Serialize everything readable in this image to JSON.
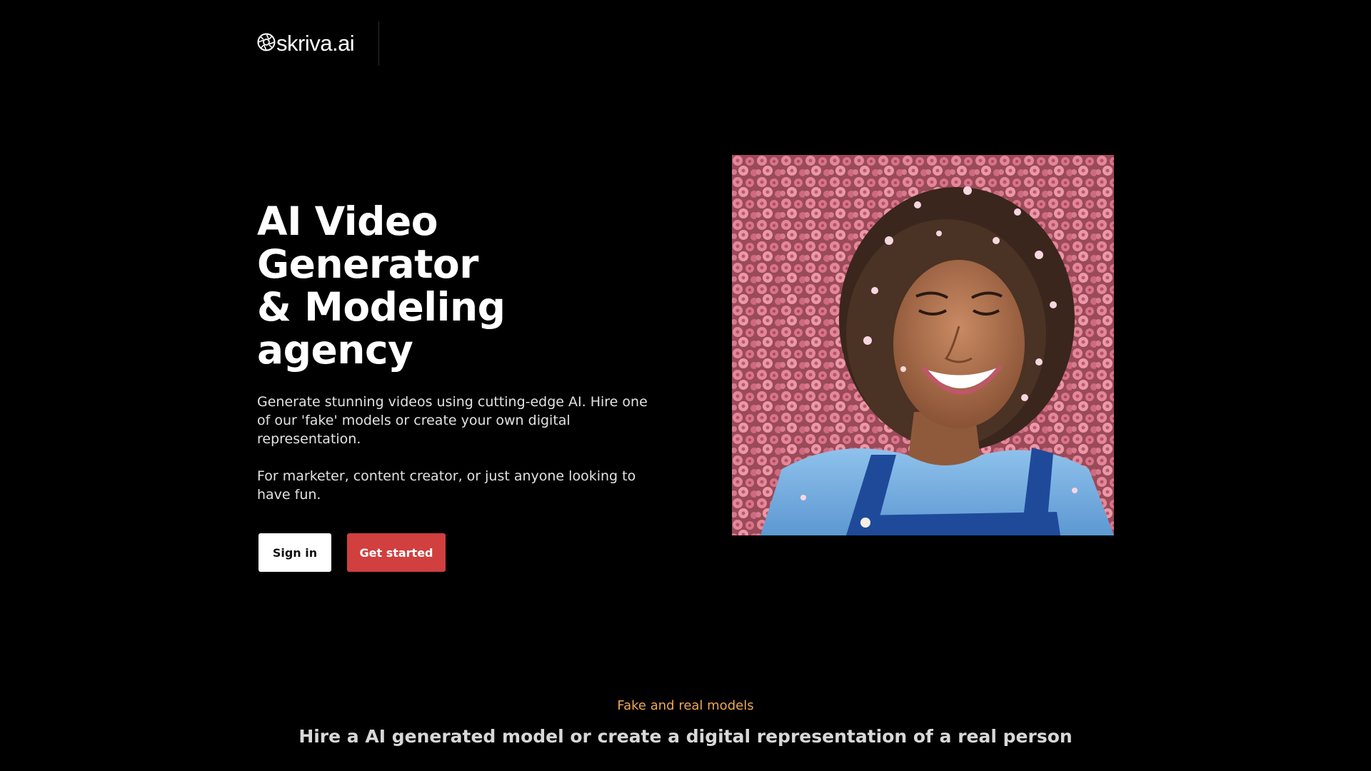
{
  "header": {
    "logo_text": "skriva.ai",
    "logo_icon": "aperture-icon"
  },
  "hero": {
    "title_line1": "AI Video Generator",
    "title_line2": "& Modeling agency",
    "description": "Generate stunning videos using cutting-edge AI. Hire one of our 'fake' models or create your own digital representation.",
    "audience": "For marketer, content creator, or just anyone looking to have fun.",
    "signin_label": "Sign in",
    "get_started_label": "Get started",
    "image_alt": "Smiling woman lying in pink flowers"
  },
  "models_section": {
    "eyebrow": "Fake and real models",
    "title": "Hire a AI generated model or create a digital representation of a real person"
  },
  "colors": {
    "background": "#000000",
    "accent_red": "#d13f3f",
    "accent_orange": "#f0a755"
  }
}
